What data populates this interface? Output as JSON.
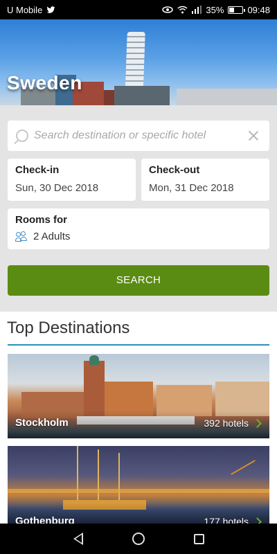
{
  "status_bar": {
    "carrier": "U Mobile",
    "battery": "35%",
    "battery_level": 0.35,
    "time": "09:48",
    "icons": [
      "twitter-icon",
      "eye-icon",
      "wifi-icon",
      "signal-icon",
      "battery-icon"
    ]
  },
  "hero": {
    "title": "Sweden"
  },
  "search": {
    "placeholder": "Search destination or specific hotel",
    "value": ""
  },
  "checkin": {
    "label": "Check-in",
    "date": "Sun, 30 Dec 2018"
  },
  "checkout": {
    "label": "Check-out",
    "date": "Mon, 31 Dec 2018"
  },
  "rooms": {
    "label": "Rooms for",
    "value": "2 Adults"
  },
  "search_button": {
    "label": "SEARCH",
    "color": "#5a8c14"
  },
  "destinations": {
    "title": "Top Destinations",
    "accent": "#2d8fb8",
    "items": [
      {
        "name": "Stockholm",
        "hotels": "392 hotels"
      },
      {
        "name": "Gothenburg",
        "hotels": "177 hotels"
      }
    ]
  },
  "nav": {
    "icons": [
      "back-icon",
      "home-icon",
      "recent-apps-icon"
    ]
  }
}
